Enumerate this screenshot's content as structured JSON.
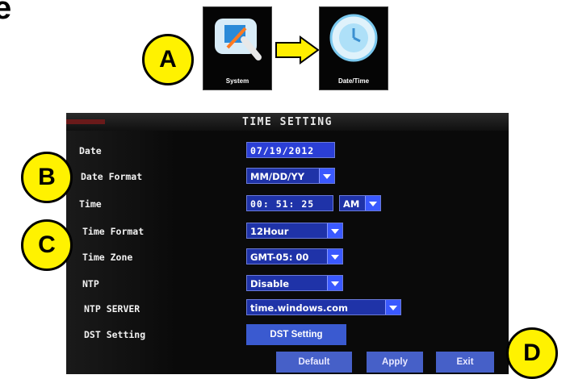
{
  "page_letter": "e",
  "tiles": {
    "system_label": "System",
    "datetime_label": "Date/Time"
  },
  "callouts": {
    "a": "A",
    "b": "B",
    "c": "C",
    "d": "D"
  },
  "screen": {
    "title": "TIME SETTING",
    "rows": {
      "date": {
        "label": "Date",
        "value": "07/19/2012"
      },
      "date_format": {
        "label": "Date Format",
        "value": "MM/DD/YY"
      },
      "time": {
        "label": "Time",
        "value": "00: 51: 25",
        "ampm": "AM"
      },
      "time_format": {
        "label": "Time Format",
        "value": "12Hour"
      },
      "time_zone": {
        "label": "Time Zone",
        "value": "GMT-05: 00"
      },
      "ntp": {
        "label": "NTP",
        "value": "Disable"
      },
      "ntp_server": {
        "label": "NTP SERVER",
        "value": "time.windows.com"
      },
      "dst": {
        "label": "DST Setting",
        "button": "DST Setting"
      }
    },
    "buttons": {
      "default": "Default",
      "apply": "Apply",
      "exit": "Exit"
    }
  },
  "colors": {
    "callout": "#fff200",
    "field": "#1f33a8",
    "dropdown": "#3a59ff",
    "button": "#4660c8",
    "arrow": "#ffee00"
  }
}
